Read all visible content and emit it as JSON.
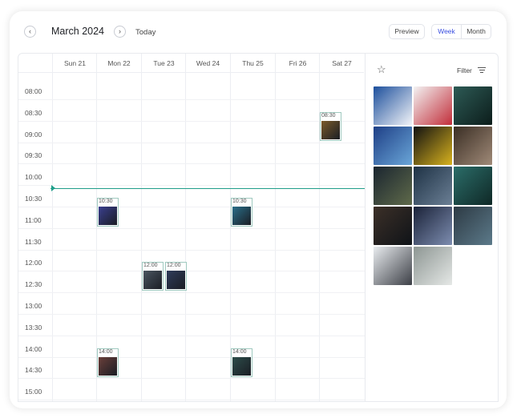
{
  "header": {
    "month_label": "March 2024",
    "today_label": "Today",
    "preview_label": "Preview",
    "views": [
      "Week",
      "Month"
    ],
    "active_view": "Week"
  },
  "days": [
    "Sun 21",
    "Mon 22",
    "Tue 23",
    "Wed 24",
    "Thu 25",
    "Fri 26",
    "Sat 27"
  ],
  "times": [
    "08:00",
    "08:30",
    "09:00",
    "09:30",
    "10:00",
    "10:30",
    "11:00",
    "11:30",
    "12:00",
    "12:30",
    "13:00",
    "13:30",
    "14:00",
    "14:30",
    "15:00"
  ],
  "events": [
    {
      "day": "Mon 22",
      "time": "10:30"
    },
    {
      "day": "Thu 25",
      "time": "10:30"
    },
    {
      "day": "Sat 27",
      "time": "08:30"
    },
    {
      "day": "Tue 23",
      "time": "12:00"
    },
    {
      "day": "Tue 23",
      "time": "12:00"
    },
    {
      "day": "Mon 22",
      "time": "14:00"
    },
    {
      "day": "Thu 25",
      "time": "14:00"
    }
  ],
  "sidebar": {
    "filter_label": "Filter"
  },
  "colors": {
    "accent": "#3b4fe0",
    "now_line": "#1f9e8a",
    "event_border": "#9fc9bf"
  }
}
